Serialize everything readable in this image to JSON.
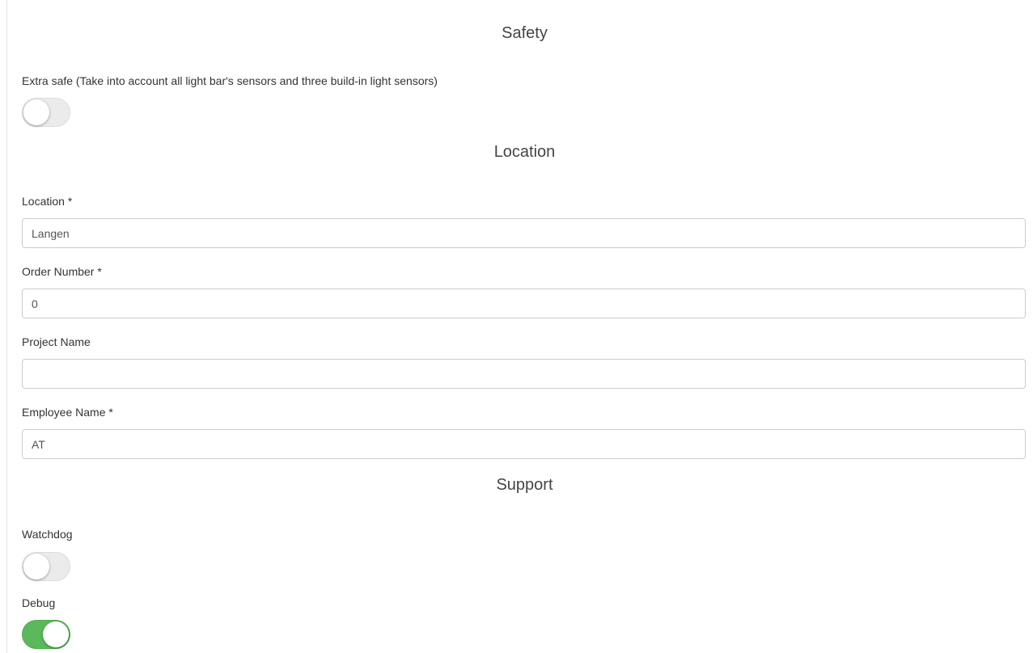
{
  "safety": {
    "title": "Safety",
    "extra_safe_label": "Extra safe (Take into account all light bar's sensors and three build-in light sensors)",
    "extra_safe_enabled": false
  },
  "location": {
    "title": "Location",
    "location_label": "Location *",
    "location_value": "Langen",
    "order_number_label": "Order Number *",
    "order_number_value": "0",
    "project_name_label": "Project Name",
    "project_name_value": "",
    "employee_name_label": "Employee Name *",
    "employee_name_value": "AT"
  },
  "support": {
    "title": "Support",
    "watchdog_label": "Watchdog",
    "watchdog_enabled": false,
    "debug_label": "Debug",
    "debug_enabled": true
  },
  "colors": {
    "toggle_on": "#5cb85c",
    "toggle_off": "#ebebeb"
  }
}
